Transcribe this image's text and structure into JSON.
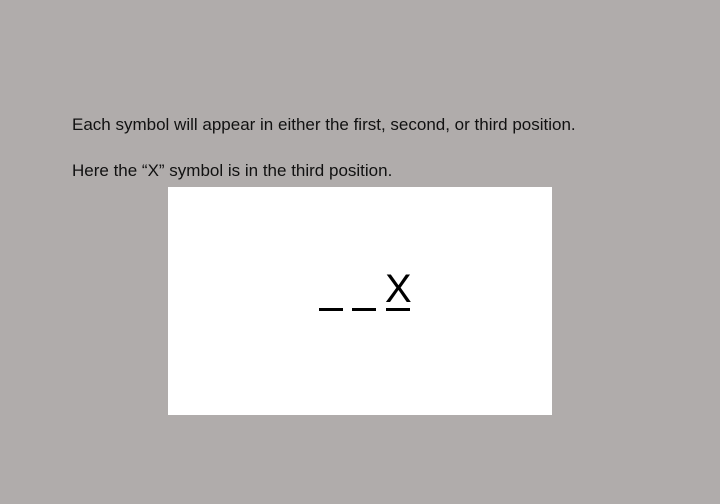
{
  "instructions": {
    "line1": "Each symbol will appear in either the first, second, or third position.",
    "line2": "Here the “X” symbol is in the third position."
  },
  "example": {
    "slots": [
      {
        "symbol": ""
      },
      {
        "symbol": ""
      },
      {
        "symbol": "X"
      }
    ]
  },
  "colors": {
    "background": "#b0acab",
    "panel": "#ffffff",
    "text": "#111111"
  }
}
